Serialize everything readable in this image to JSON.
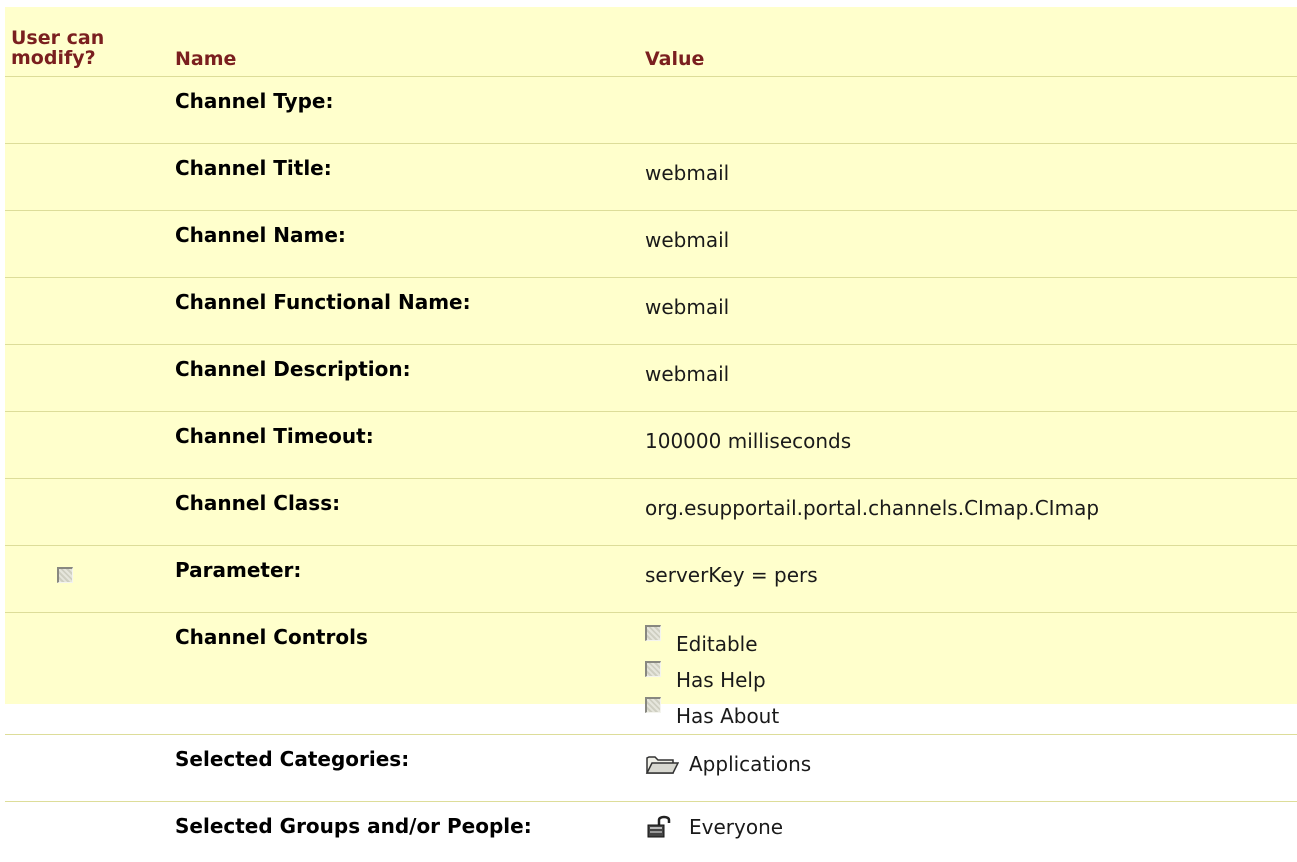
{
  "headers": {
    "modify_line1": "User can",
    "modify_line2": "modify?",
    "name": "Name",
    "value": "Value"
  },
  "rows": [
    {
      "name": "Channel Type:",
      "value": ""
    },
    {
      "name": "Channel Title:",
      "value": "webmail"
    },
    {
      "name": "Channel Name:",
      "value": "webmail"
    },
    {
      "name": "Channel Functional Name:",
      "value": "webmail"
    },
    {
      "name": "Channel Description:",
      "value": "webmail"
    },
    {
      "name": "Channel Timeout:",
      "value": "100000 milliseconds"
    },
    {
      "name": "Channel Class:",
      "value": "org.esupportail.portal.channels.CImap.CImap"
    },
    {
      "name": "Parameter:",
      "value": "serverKey = pers"
    }
  ],
  "controls": {
    "name": "Channel Controls",
    "items": [
      {
        "label": "Editable"
      },
      {
        "label": "Has Help"
      },
      {
        "label": "Has About"
      }
    ]
  },
  "categories": {
    "name": "Selected Categories:",
    "value": "Applications",
    "icon": "folder-icon"
  },
  "groups": {
    "name": "Selected Groups and/or People:",
    "value": "Everyone",
    "icon": "unlocked-padlock-icon"
  },
  "colors": {
    "background": "#ffffcc",
    "header_text": "#7a1f1f",
    "row_divider": "#dddd99"
  }
}
